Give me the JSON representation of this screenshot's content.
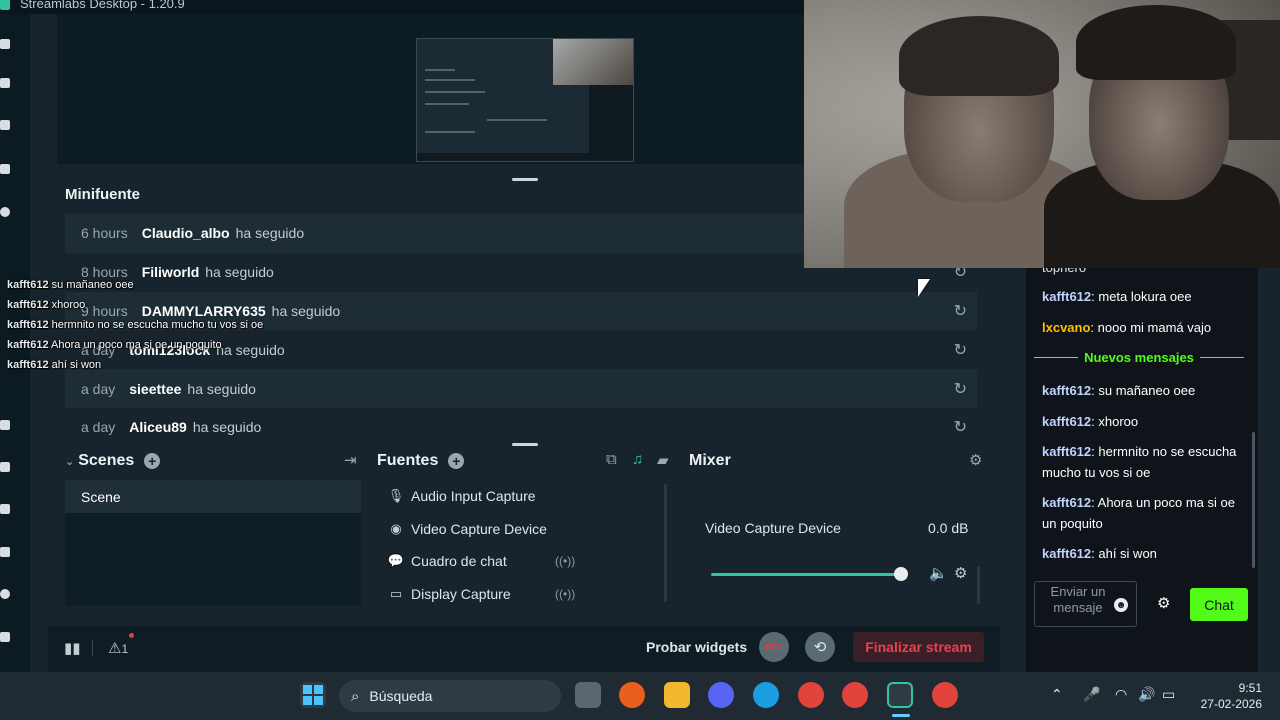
{
  "window": {
    "title": "Streamlabs Desktop - 1.20.9"
  },
  "events": {
    "title": "Minifuente",
    "rows": [
      {
        "time": "6 hours",
        "user": "Claudio_albo",
        "action": "ha seguido"
      },
      {
        "time": "8 hours",
        "user": "Filiworld",
        "action": "ha seguido"
      },
      {
        "time": "9 hours",
        "user": "DAMMYLARRY635",
        "action": "ha seguido"
      },
      {
        "time": "a day",
        "user": "tomi123lock",
        "action": "ha seguido"
      },
      {
        "time": "a day",
        "user": "sieettee",
        "action": "ha seguido"
      },
      {
        "time": "a day",
        "user": "Aliceu89",
        "action": "ha seguido"
      }
    ]
  },
  "overlay_chat": [
    {
      "user": "kafft612",
      "text": "su mañaneo oee"
    },
    {
      "user": "kafft612",
      "text": "xhoroo"
    },
    {
      "user": "kafft612",
      "text": "hermnito no se escucha mucho tu vos si oe"
    },
    {
      "user": "kafft612",
      "text": "Ahora un poco ma si oe un poquito"
    },
    {
      "user": "kafft612",
      "text": "ahí si won"
    }
  ],
  "scenes": {
    "title": "Scenes",
    "items": [
      "Scene"
    ]
  },
  "sources": {
    "title": "Fuentes",
    "items": [
      {
        "label": "Audio Input Capture",
        "icon": "microphone-icon"
      },
      {
        "label": "Video Capture Device",
        "icon": "webcam-icon"
      },
      {
        "label": "Cuadro de chat",
        "icon": "chat-bubbles-icon"
      },
      {
        "label": "Display Capture",
        "icon": "monitor-icon"
      }
    ]
  },
  "mixer": {
    "title": "Mixer",
    "source": "Video Capture Device",
    "level": "0.0 dB",
    "volume": 1.0
  },
  "footer": {
    "alerts_count": "1",
    "test_widgets": "Probar widgets",
    "rec": "REC",
    "end_stream": "Finalizar stream"
  },
  "chat": {
    "partial_top": "topnero",
    "messages_before": [
      {
        "user": "kafft612",
        "text": "meta lokura oee",
        "alt": false
      },
      {
        "user": "lxcvano",
        "text": "nooo mi mamá vajo",
        "alt": true
      }
    ],
    "new_messages_label": "Nuevos mensajes",
    "messages_after": [
      {
        "user": "kafft612",
        "text": "su mañaneo oee"
      },
      {
        "user": "kafft612",
        "text": "xhoroo"
      },
      {
        "user": "kafft612",
        "text": "hermnito no se escucha mucho tu vos si oe"
      },
      {
        "user": "kafft612",
        "text": "Ahora un poco ma si oe un poquito"
      },
      {
        "user": "kafft612",
        "text": "ahí si won"
      }
    ],
    "input_placeholder": "Enviar un mensaje",
    "send_label": "Chat"
  },
  "taskbar": {
    "search": "Búsqueda",
    "time": "9:51",
    "date": "27-02-2026"
  },
  "colors": {
    "accent": "#31c3a2",
    "chat_green": "#53fc18",
    "danger": "#e8414f",
    "panel_bg": "#17242d"
  }
}
